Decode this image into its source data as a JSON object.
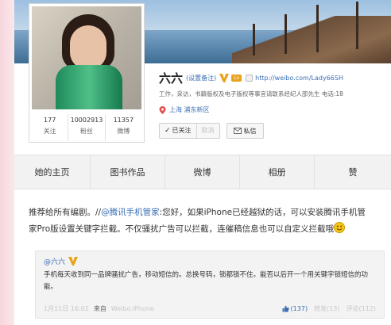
{
  "profile": {
    "stats": [
      {
        "num": "177",
        "label": "关注"
      },
      {
        "num": "10002913",
        "label": "粉丝"
      },
      {
        "num": "11357",
        "label": "微博"
      }
    ],
    "name": "六六",
    "remark": "(设置备注)",
    "level_badge": "Lv",
    "url": "http://weibo.com/Lady66SH",
    "work": "工作，采访，书籍版权及电子版权等事宜请联系经纪人邵先生 电话:18",
    "location": "上海 浦东新区",
    "followed_label": "已关注",
    "unfollow_label": "取消",
    "message_label": "私信"
  },
  "tabs": [
    {
      "label": "她的主页"
    },
    {
      "label": "图书作品"
    },
    {
      "label": "微博"
    },
    {
      "label": "相册"
    },
    {
      "label": "赞"
    }
  ],
  "post": {
    "line1_a": "推荐给所有编剧。//",
    "mention": "@腾讯手机管家",
    "line1_b": ":您好，如果iPhone已经越狱的话，可以安装腾讯手机管",
    "line2": "家Pro版设置关键字拦截。不仅骚扰广告可以拦截，连催稿信息也可以自定义拦截哦"
  },
  "repost": {
    "author": "@六六",
    "text": "手机每天收到同一品牌骚扰广告，移动短信的。总换号码，锁都锁不住。能否以后开一个用关键字锁短信的功能。",
    "time": "1月11日 16:02",
    "from_label": "来自",
    "source": "Weibo.iPhone",
    "likes": "(137)",
    "reposts": "转发(13)",
    "comments": "评论(112)"
  },
  "colors": {
    "link": "#3b6fb6",
    "accent_badge": "#e8a21d",
    "pink_strip": "#f6d7dd"
  }
}
